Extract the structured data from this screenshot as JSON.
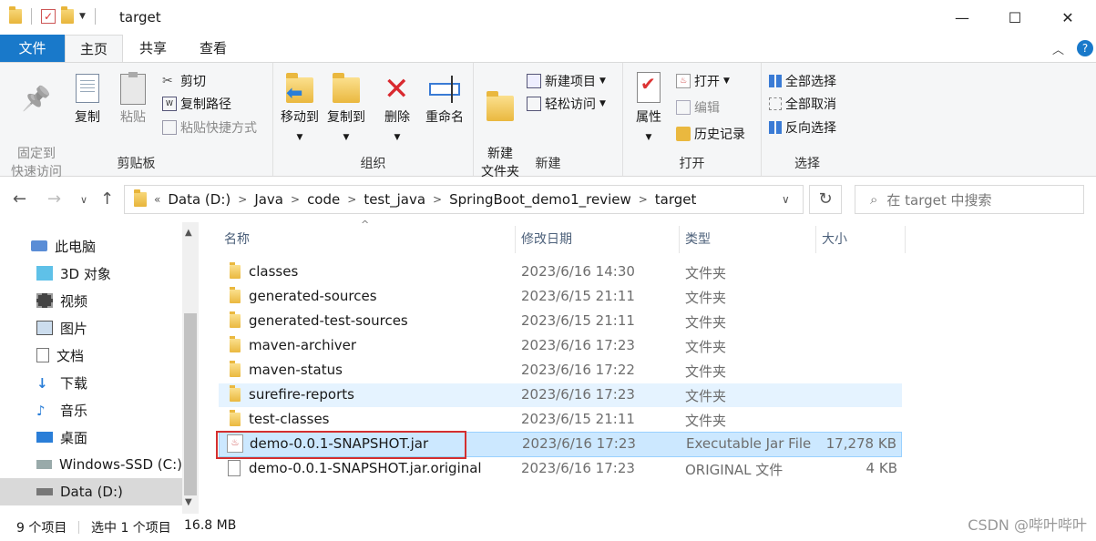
{
  "window": {
    "title": "target",
    "controls": {
      "minimize": "—",
      "maximize": "☐",
      "close": "✕"
    }
  },
  "ribbon_tabs": [
    "文件",
    "主页",
    "共享",
    "查看"
  ],
  "ribbon": {
    "clipboard": {
      "label": "剪贴板",
      "pin": "固定到\n快速访问",
      "copy": "复制",
      "paste": "粘贴",
      "cut": "剪切",
      "copy_path": "复制路径",
      "paste_shortcut": "粘贴快捷方式"
    },
    "organize": {
      "label": "组织",
      "move_to": "移动到",
      "copy_to": "复制到",
      "delete": "删除",
      "rename": "重命名"
    },
    "new": {
      "label": "新建",
      "new_folder": "新建\n文件夹",
      "new_item": "新建项目",
      "easy_access": "轻松访问"
    },
    "open": {
      "label": "打开",
      "properties": "属性",
      "open": "打开",
      "edit": "编辑",
      "history": "历史记录"
    },
    "select": {
      "label": "选择",
      "select_all": "全部选择",
      "select_none": "全部取消",
      "invert": "反向选择"
    }
  },
  "address": {
    "crumbs": [
      "Data (D:)",
      "Java",
      "code",
      "test_java",
      "SpringBoot_demo1_review",
      "target"
    ],
    "search_placeholder": "在 target 中搜索"
  },
  "nav_pane": [
    {
      "label": "此电脑",
      "icon": "computer-icon"
    },
    {
      "label": "3D 对象",
      "icon": "3d-objects-icon"
    },
    {
      "label": "视频",
      "icon": "video-icon"
    },
    {
      "label": "图片",
      "icon": "pictures-icon"
    },
    {
      "label": "文档",
      "icon": "documents-icon"
    },
    {
      "label": "下载",
      "icon": "download-icon"
    },
    {
      "label": "音乐",
      "icon": "music-icon"
    },
    {
      "label": "桌面",
      "icon": "desktop-icon"
    },
    {
      "label": "Windows-SSD (C:)",
      "icon": "drive-icon"
    },
    {
      "label": "Data (D:)",
      "icon": "drive-icon"
    }
  ],
  "columns": {
    "name": "名称",
    "modified": "修改日期",
    "type": "类型",
    "size": "大小"
  },
  "files": [
    {
      "name": "classes",
      "modified": "2023/6/16 14:30",
      "type": "文件夹",
      "size": "",
      "kind": "folder"
    },
    {
      "name": "generated-sources",
      "modified": "2023/6/15 21:11",
      "type": "文件夹",
      "size": "",
      "kind": "folder"
    },
    {
      "name": "generated-test-sources",
      "modified": "2023/6/15 21:11",
      "type": "文件夹",
      "size": "",
      "kind": "folder"
    },
    {
      "name": "maven-archiver",
      "modified": "2023/6/16 17:23",
      "type": "文件夹",
      "size": "",
      "kind": "folder"
    },
    {
      "name": "maven-status",
      "modified": "2023/6/16 17:22",
      "type": "文件夹",
      "size": "",
      "kind": "folder"
    },
    {
      "name": "surefire-reports",
      "modified": "2023/6/16 17:23",
      "type": "文件夹",
      "size": "",
      "kind": "folder"
    },
    {
      "name": "test-classes",
      "modified": "2023/6/15 21:11",
      "type": "文件夹",
      "size": "",
      "kind": "folder"
    },
    {
      "name": "demo-0.0.1-SNAPSHOT.jar",
      "modified": "2023/6/16 17:23",
      "type": "Executable Jar File",
      "size": "17,278 KB",
      "kind": "jar"
    },
    {
      "name": "demo-0.0.1-SNAPSHOT.jar.original",
      "modified": "2023/6/16 17:23",
      "type": "ORIGINAL 文件",
      "size": "4 KB",
      "kind": "file"
    }
  ],
  "status": {
    "count": "9 个项目",
    "selection": "选中 1 个项目",
    "selection_size": "16.8 MB"
  },
  "watermark": "CSDN @哔叶哔叶"
}
